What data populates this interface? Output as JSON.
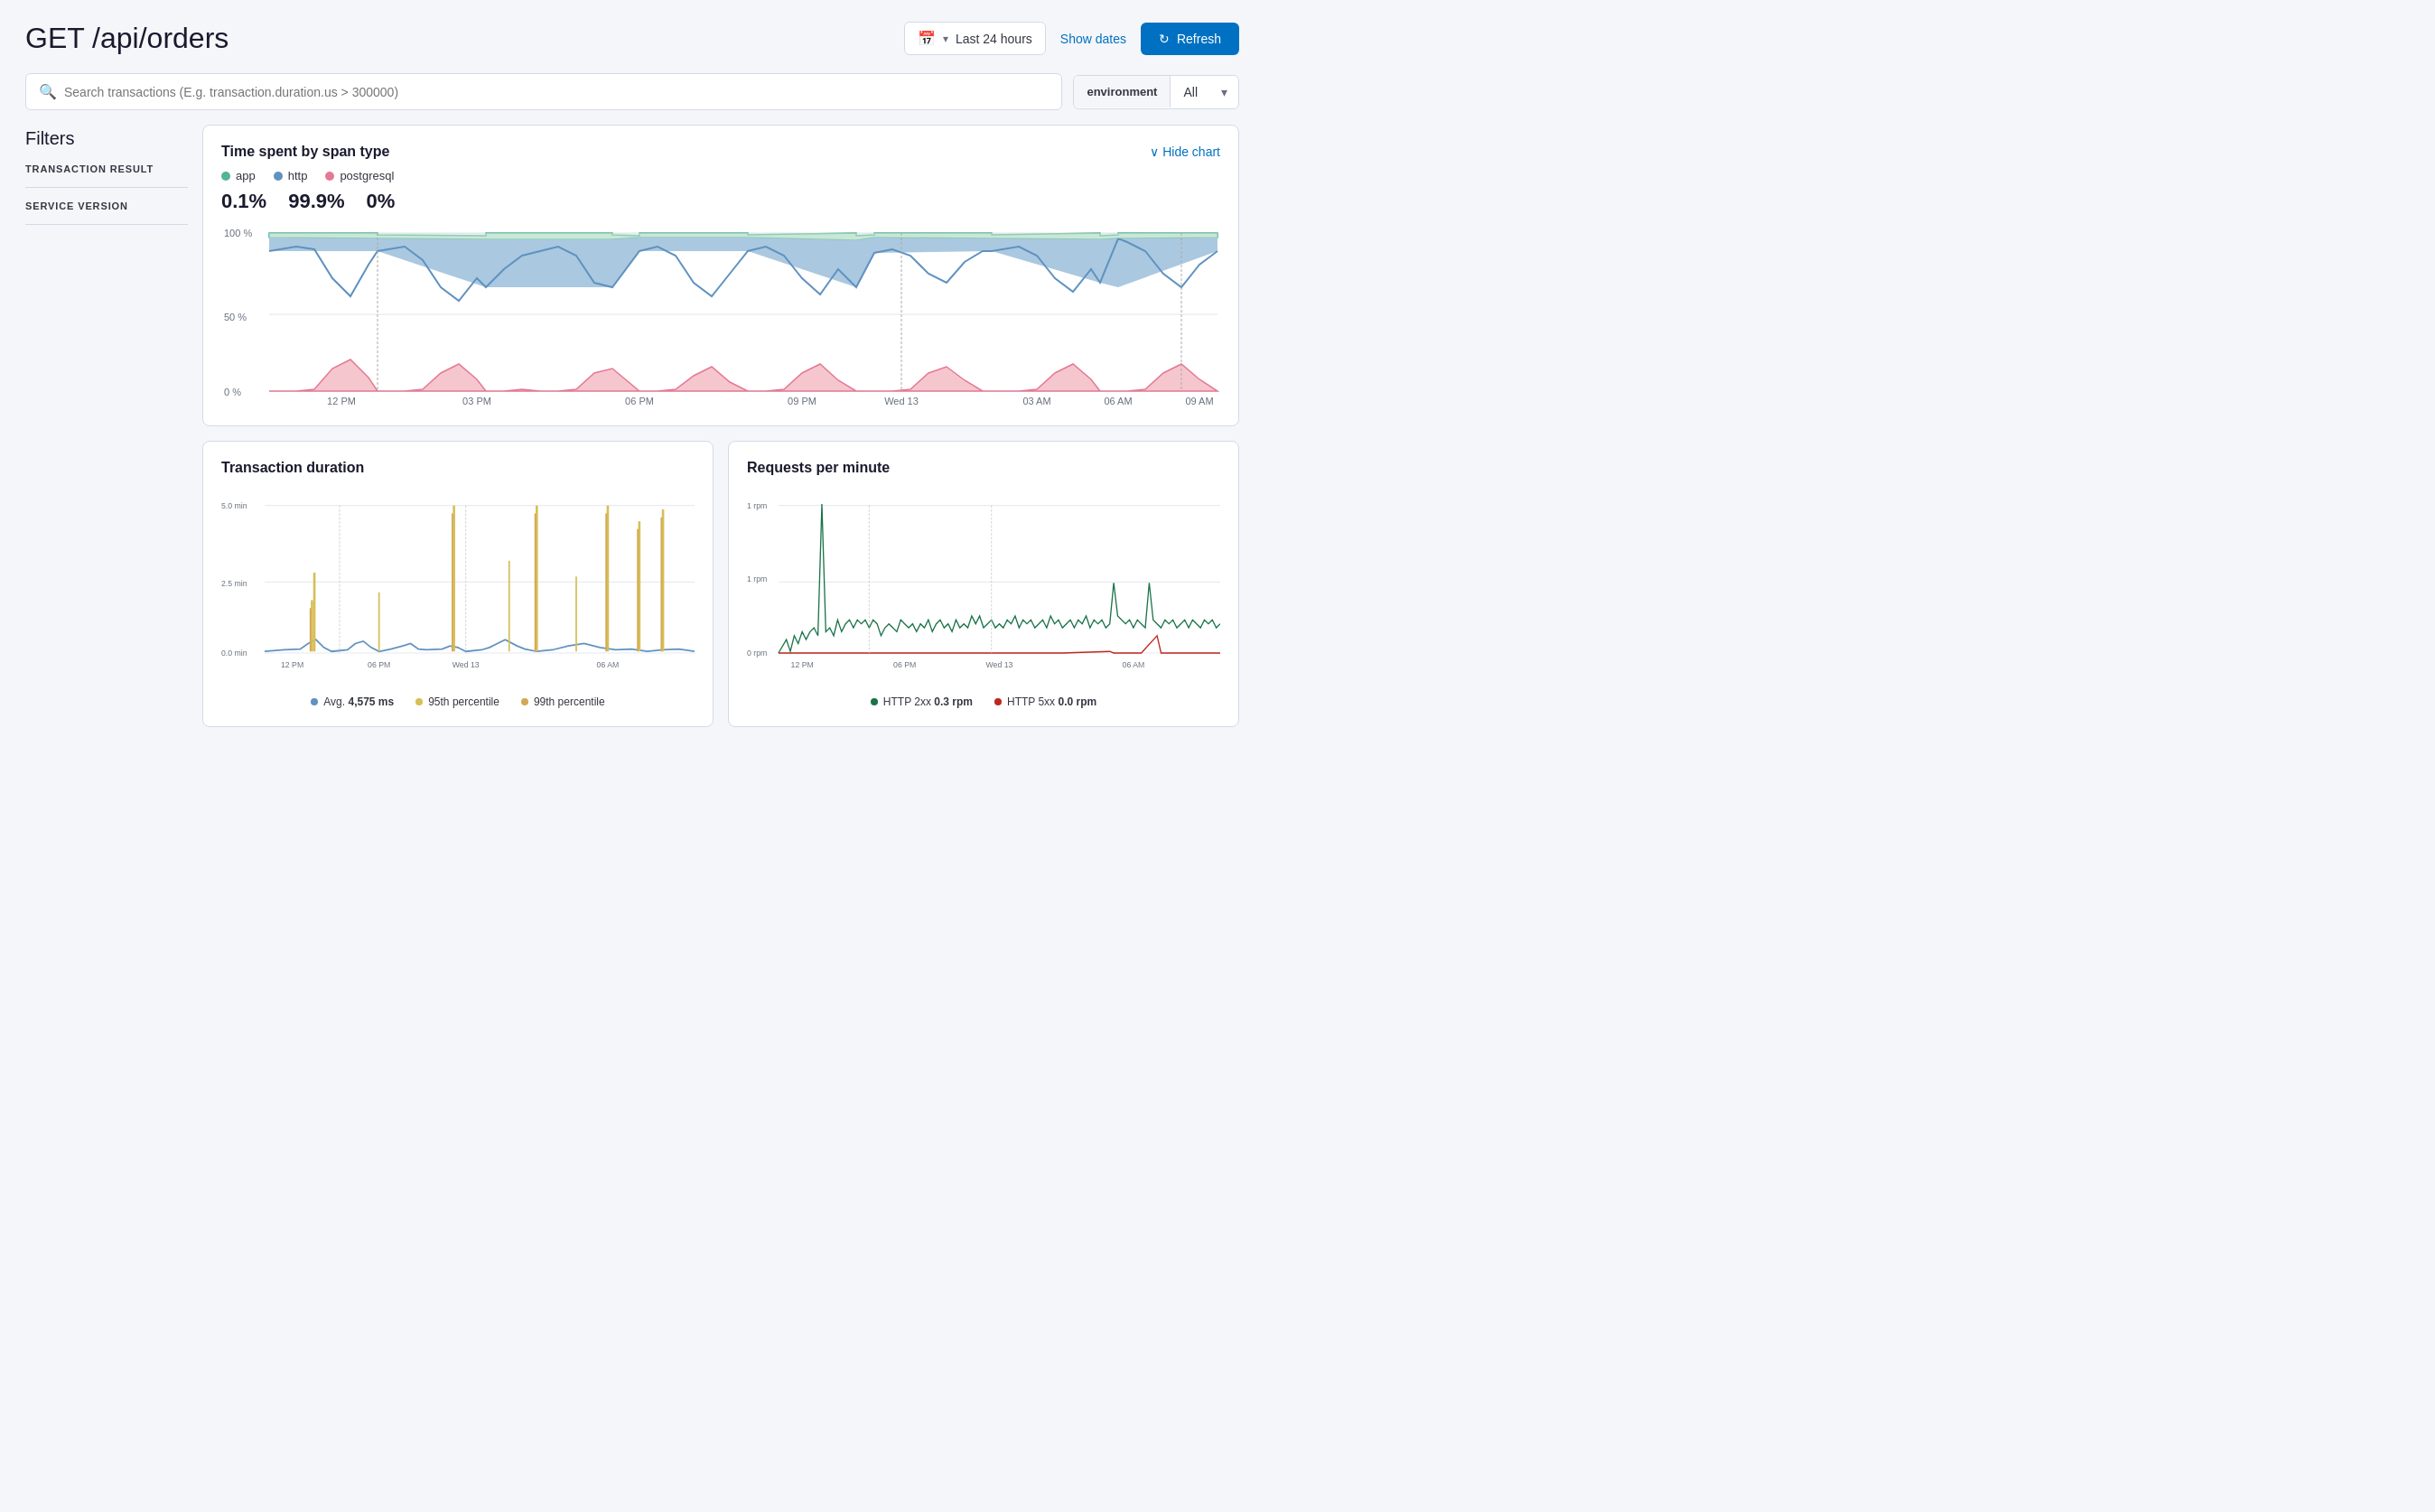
{
  "page": {
    "title": "GET /api/orders"
  },
  "header": {
    "time_range": "Last 24 hours",
    "show_dates_label": "Show dates",
    "refresh_label": "Refresh",
    "calendar_icon": "📅"
  },
  "search": {
    "placeholder": "Search transactions (E.g. transaction.duration.us > 300000)"
  },
  "env_filter": {
    "label": "environment",
    "value": "All"
  },
  "sidebar": {
    "filters_title": "Filters",
    "transaction_result_label": "TRANSACTION RESULT",
    "service_version_label": "SERVICE VERSION"
  },
  "span_chart": {
    "title": "Time spent by span type",
    "hide_chart_label": "Hide chart",
    "legend": [
      {
        "name": "app",
        "color": "#54b399"
      },
      {
        "name": "http",
        "color": "#6092c0"
      },
      {
        "name": "postgresql",
        "color": "#e57994"
      }
    ],
    "percentages": [
      {
        "value": "0.1%",
        "color": "#54b399"
      },
      {
        "value": "99.9%",
        "color": "#6092c0"
      },
      {
        "value": "0%",
        "color": "#e57994"
      }
    ],
    "y_labels": [
      "100 %",
      "50 %",
      "0 %"
    ],
    "x_labels": [
      "12 PM",
      "03 PM",
      "06 PM",
      "09 PM",
      "Wed 13",
      "03 AM",
      "06 AM",
      "09 AM"
    ]
  },
  "duration_chart": {
    "title": "Transaction duration",
    "y_labels": [
      "5.0 min",
      "2.5 min",
      "0.0 min"
    ],
    "x_labels": [
      "12 PM",
      "06 PM",
      "Wed 13",
      "06 AM"
    ],
    "legend": [
      {
        "name": "Avg.",
        "value": "4,575 ms",
        "color": "#6092c0"
      },
      {
        "name": "95th percentile",
        "color": "#d6bf57"
      },
      {
        "name": "99th percentile",
        "color": "#d4a853"
      }
    ]
  },
  "requests_chart": {
    "title": "Requests per minute",
    "y_labels": [
      "1 rpm",
      "1 rpm",
      "0 rpm"
    ],
    "x_labels": [
      "12 PM",
      "06 PM",
      "Wed 13",
      "06 AM"
    ],
    "legend": [
      {
        "name": "HTTP 2xx",
        "value": "0.3 rpm",
        "color": "#1a7348"
      },
      {
        "name": "HTTP 5xx",
        "value": "0.0 rpm",
        "color": "#bd271e"
      }
    ]
  },
  "colors": {
    "accent": "#0071c2",
    "app_green": "#54b399",
    "http_blue": "#6092c0",
    "psql_pink": "#e57994",
    "yellow": "#d6bf57",
    "orange": "#d4a853",
    "dark_green": "#1a7348",
    "red": "#bd271e"
  }
}
